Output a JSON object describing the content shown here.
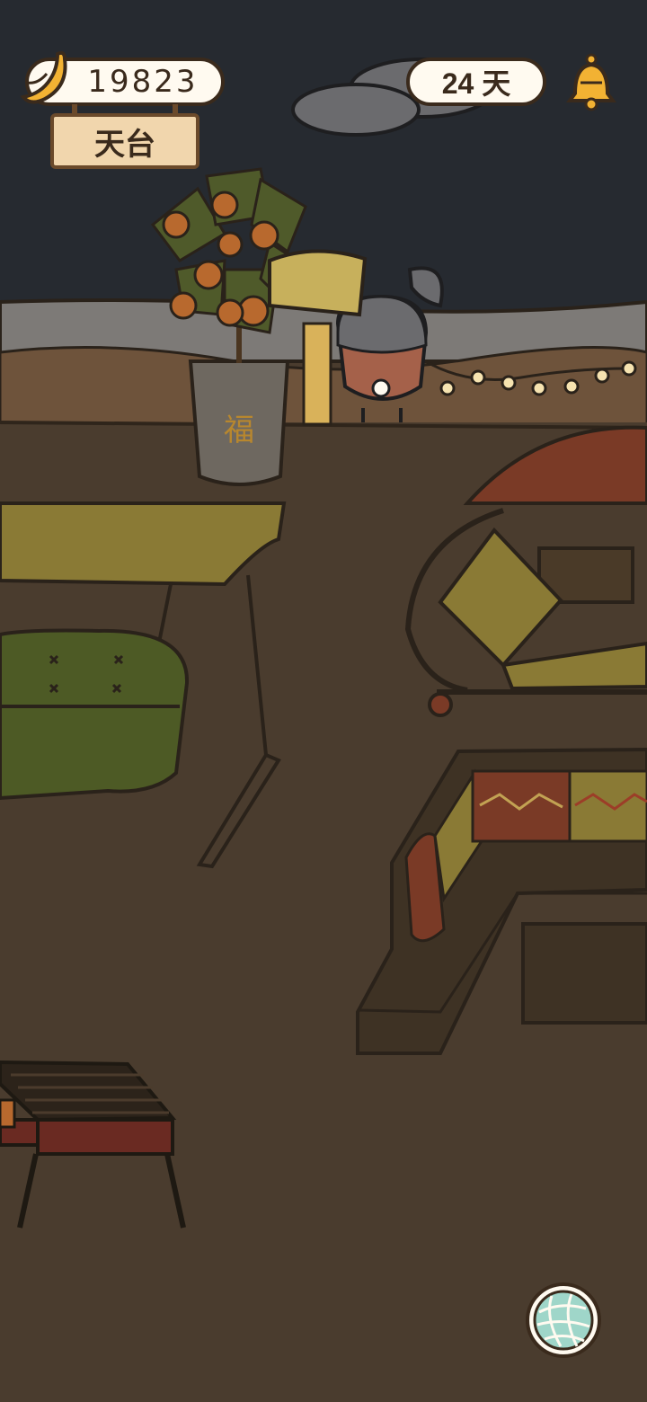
{
  "hud": {
    "coins": "19823",
    "days": "24 天",
    "location": "天台"
  },
  "icons": {
    "currency": "banana-icon",
    "notifications": "bell-icon",
    "action": "yarn-ball-icon"
  },
  "colors": {
    "night_sky": "#262a30",
    "rooftop_floor": "#4a3c2e",
    "pill_fill": "#fffaf0",
    "outline": "#3a2a1c",
    "bell_gold": "#f2b233",
    "yarn_teal": "#9fd6c9"
  }
}
